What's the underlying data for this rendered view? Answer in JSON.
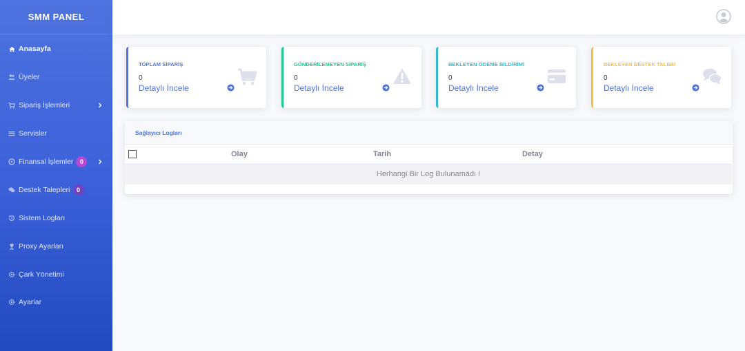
{
  "sidebar": {
    "brand": "SMM PANEL",
    "items": [
      {
        "label": "Anasayfa",
        "icon": "home-icon",
        "active": true
      },
      {
        "label": "Üyeler",
        "icon": "users-icon"
      },
      {
        "label": "Sipariş İşlemleri",
        "icon": "cart-icon",
        "chevron": true
      },
      {
        "label": "Servisler",
        "icon": "list-icon"
      },
      {
        "label": "Finansal İşlemler",
        "icon": "money-icon",
        "badge": "0",
        "badge_color": "#b44bd6",
        "chevron": true
      },
      {
        "label": "Destek Talepleri",
        "icon": "comments-icon",
        "badge": "0",
        "badge_color": "#6f42c1"
      },
      {
        "label": "Sistem Logları",
        "icon": "history-icon"
      },
      {
        "label": "Proxy Ayarları",
        "icon": "user-secret-icon"
      },
      {
        "label": "Çark Yönetimi",
        "icon": "gear-icon"
      },
      {
        "label": "Ayarlar",
        "icon": "gear-icon"
      }
    ]
  },
  "cards": [
    {
      "title": "TOPLAM SİPARİŞ",
      "value": "0",
      "link": "Detaylı İncele",
      "color": "#4e73df",
      "icon": "cart-icon"
    },
    {
      "title": "GÖNDERİLEMEYEN SİPARİŞ",
      "value": "0",
      "link": "Detaylı İncele",
      "color": "#1cc88a",
      "icon": "warning-icon"
    },
    {
      "title": "BEKLEYEN ÖDEME BİLDİRİMİ",
      "value": "0",
      "link": "Detaylı İncele",
      "color": "#36b9cc",
      "icon": "credit-card-icon"
    },
    {
      "title": "BEKLEYEN DESTEK TALEBİ",
      "value": "0",
      "link": "Detaylı İncele",
      "color": "#f6c23e",
      "icon": "comments-icon"
    }
  ],
  "logs": {
    "title": "Sağlayıcı Logları",
    "columns": [
      "Olay",
      "Tarih",
      "Detay"
    ],
    "empty_message": "Herhangi Bir Log Bulunamadı !"
  }
}
